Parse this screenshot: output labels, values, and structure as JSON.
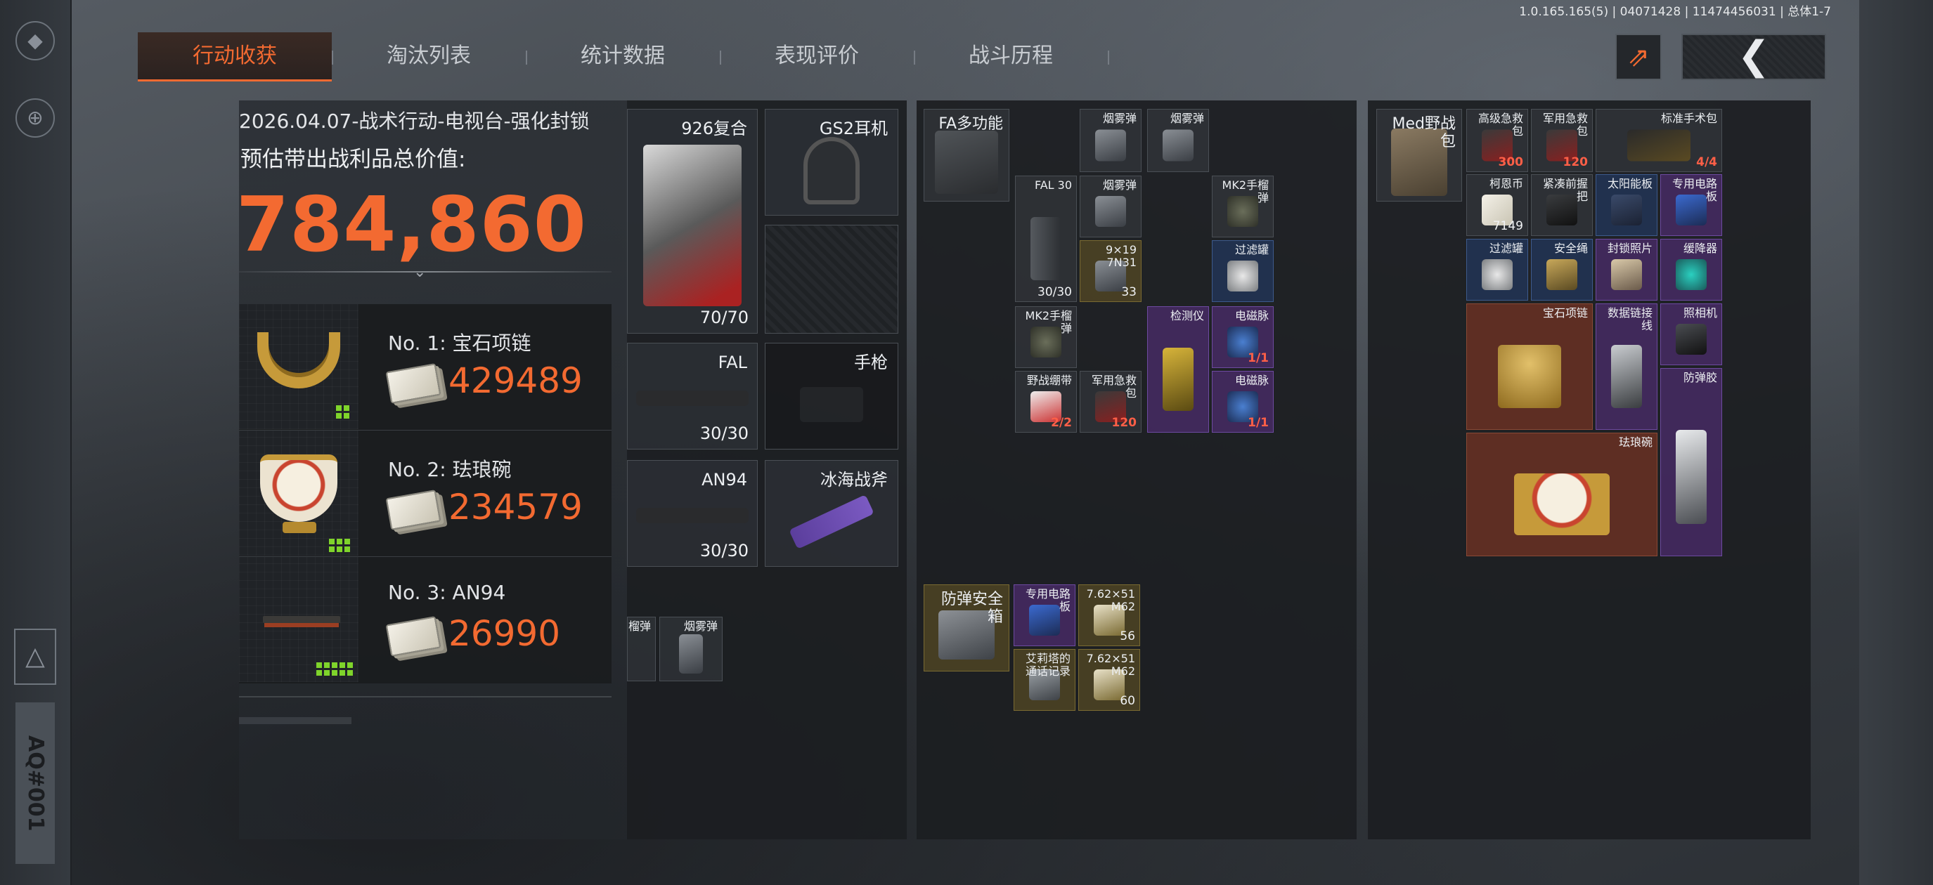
{
  "version": "1.0.165.165(5) | 04071428 | 11474456031 | 总体1-7",
  "side": {
    "code": "AQ#001"
  },
  "tabs": [
    {
      "label": "行动收获",
      "active": true
    },
    {
      "label": "淘汰列表",
      "active": false
    },
    {
      "label": "统计数据",
      "active": false
    },
    {
      "label": "表现评价",
      "active": false
    },
    {
      "label": "战斗历程",
      "active": false
    }
  ],
  "header": {
    "share_icon": "share-icon",
    "back_icon": "chevron-left-icon",
    "back_glyph": "❮"
  },
  "colors": {
    "accent": "#f36a31",
    "green": "#7fd42b",
    "blue_rarity": "#3d5a8c",
    "purple_rarity": "#6d4aa0",
    "gold_rarity": "#7a6a32",
    "red_rarity": "#8a4a36"
  },
  "summary": {
    "date_line": "2026.04.07-战术行动-电视台-强化封锁",
    "label": "预估带出战利品总价值:",
    "total_value": "784,860",
    "top_items": [
      {
        "name": "No. 1: 宝石项链",
        "price": "429489",
        "size_cells": 2
      },
      {
        "name": "No. 2: 珐琅碗",
        "price": "234579",
        "size_cells": 4
      },
      {
        "name": "No. 3: AN94",
        "price": "26990",
        "size_cells": 12
      }
    ]
  },
  "equipment": {
    "armor": {
      "name": "926复合",
      "count": "70/70"
    },
    "headset": {
      "name": "GS2耳机"
    },
    "primary1": {
      "name": "FAL",
      "count": "30/30"
    },
    "pistol": {
      "name": "手枪"
    },
    "primary2": {
      "name": "AN94",
      "count": "30/30"
    },
    "melee": {
      "name": "冰海战斧"
    },
    "pockets": [
      {
        "name": "榴弹"
      },
      {
        "name": "烟雾弹"
      }
    ]
  },
  "chest_rig": {
    "rig": {
      "name": "FA多功能"
    },
    "items": [
      {
        "name": "烟雾弹",
        "count": ""
      },
      {
        "name": "烟雾弹",
        "count": ""
      },
      {
        "name": "FAL 30",
        "count": "30/30"
      },
      {
        "name": "烟雾弹",
        "count": ""
      },
      {
        "name": "MK2手榴弹",
        "count": ""
      },
      {
        "name": "9×19 7N31",
        "count": "33"
      },
      {
        "name": "过滤罐",
        "count": ""
      },
      {
        "name": "MK2手榴弹",
        "count": ""
      },
      {
        "name": "检测仪",
        "count": ""
      },
      {
        "name": "电磁脉",
        "count": "1/1"
      },
      {
        "name": "野战绷带",
        "count": "2/2"
      },
      {
        "name": "军用急救包",
        "count": "120"
      },
      {
        "name": "电磁脉",
        "count": "1/1"
      }
    ],
    "safe_box": {
      "name": "防弹安全箱"
    },
    "safe_items": [
      {
        "name": "专用电路板",
        "count": ""
      },
      {
        "name": "7.62×51 M62",
        "count": "56"
      },
      {
        "name": "艾莉塔的通话记录",
        "count": ""
      },
      {
        "name": "7.62×51 M62",
        "count": "60"
      }
    ]
  },
  "backpack": {
    "bag": {
      "name": "Med野战包"
    },
    "items": [
      {
        "name": "高级急救包",
        "count": "300"
      },
      {
        "name": "军用急救包",
        "count": "120"
      },
      {
        "name": "标准手术包",
        "count": "4/4"
      },
      {
        "name": "柯恩币",
        "count": "7149"
      },
      {
        "name": "紧凑前握把",
        "count": ""
      },
      {
        "name": "太阳能板",
        "count": ""
      },
      {
        "name": "专用电路板",
        "count": ""
      },
      {
        "name": "过滤罐",
        "count": ""
      },
      {
        "name": "安全绳",
        "count": ""
      },
      {
        "name": "封锁照片",
        "count": ""
      },
      {
        "name": "缓降器",
        "count": ""
      },
      {
        "name": "宝石项链",
        "count": ""
      },
      {
        "name": "数据链接线",
        "count": ""
      },
      {
        "name": "照相机",
        "count": ""
      },
      {
        "name": "防弹胶",
        "count": ""
      },
      {
        "name": "珐琅碗",
        "count": ""
      }
    ]
  }
}
